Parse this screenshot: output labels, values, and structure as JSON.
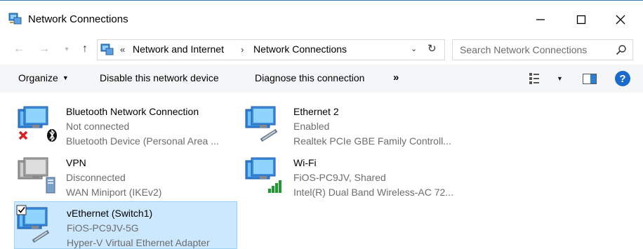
{
  "window": {
    "title": "Network Connections",
    "icons": {
      "app": "network-connections-icon",
      "minimize": "minimize-icon",
      "maximize": "maximize-icon",
      "close": "close-icon"
    }
  },
  "address": {
    "overflow": "«",
    "breadcrumbs": [
      "Network and Internet",
      "Network Connections"
    ],
    "separator": "›",
    "search_placeholder": "Search Network Connections",
    "icons": {
      "back": "back-arrow-icon",
      "forward": "forward-arrow-icon",
      "up": "up-arrow-icon",
      "refresh": "refresh-icon",
      "search": "search-icon"
    }
  },
  "toolbar": {
    "organize": "Organize",
    "disable": "Disable this network device",
    "diagnose": "Diagnose this connection",
    "more": "»",
    "help": "?",
    "icons": {
      "view": "view-options-icon",
      "preview": "preview-pane-icon",
      "help": "help-icon"
    }
  },
  "connections": [
    {
      "name": "Bluetooth Network Connection",
      "status": "Not connected",
      "device": "Bluetooth Device (Personal Area ...",
      "icon": "monitor-bluetooth-disconnected-icon"
    },
    {
      "name": "Ethernet 2",
      "status": "Enabled",
      "device": "Realtek PCIe GBE Family Controll...",
      "icon": "monitor-ethernet-icon"
    },
    {
      "name": "VPN",
      "status": "Disconnected",
      "device": "WAN Miniport (IKEv2)",
      "icon": "monitor-vpn-icon"
    },
    {
      "name": "Wi-Fi",
      "status": "FiOS-PC9JV, Shared",
      "device": "Intel(R) Dual Band Wireless-AC 72...",
      "icon": "monitor-wifi-icon"
    },
    {
      "name": "vEthernet (Switch1)",
      "status": "FiOS-PC9JV-5G",
      "device": "Hyper-V Virtual Ethernet Adapter",
      "icon": "monitor-ethernet-selected-icon"
    }
  ],
  "colors": {
    "selection_bg": "#cce8ff",
    "selection_border": "#99d1ff",
    "toolbar_bg": "#f5f6f7",
    "help_blue": "#1a6bd0",
    "status_gray": "#6d6d6d"
  }
}
